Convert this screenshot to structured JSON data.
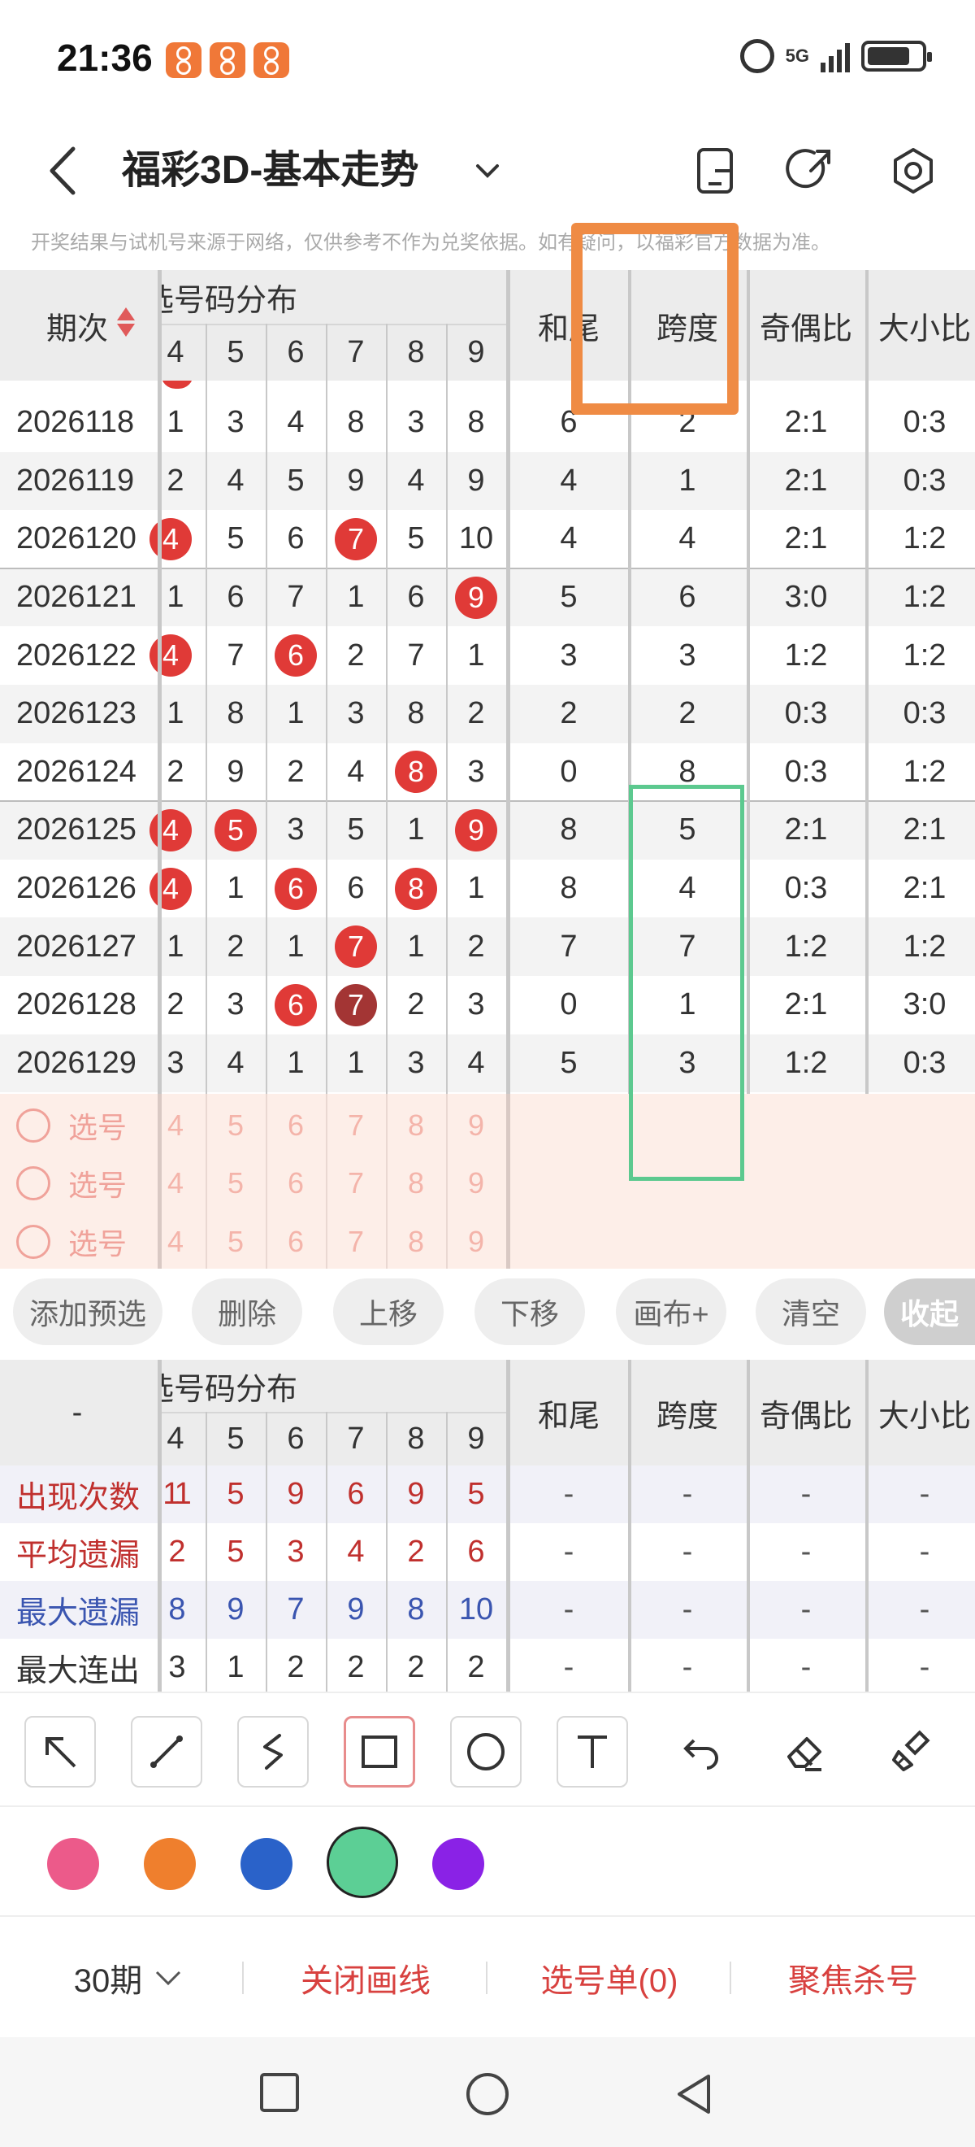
{
  "status_bar": {
    "time": "21:36",
    "network": "5G"
  },
  "header": {
    "title": "福彩3D-基本走势"
  },
  "notice": "开奖结果与试机号来源于网络，仅供参考不作为兑奖依据。如有疑问，以福彩官方数据为准。",
  "main_table": {
    "header": {
      "period": "期次",
      "group": "选号码分布",
      "numbers": [
        "4",
        "5",
        "6",
        "7",
        "8",
        "9"
      ],
      "cols": [
        "和尾",
        "跨度",
        "奇偶比",
        "大小比"
      ]
    },
    "rows": [
      {
        "period": "2026118",
        "nums": [
          "1",
          "3",
          "4",
          "8",
          "3",
          "8"
        ],
        "hl": [],
        "he": "6",
        "kd": "2",
        "jo": "2:1",
        "dx": "0:3"
      },
      {
        "period": "2026119",
        "nums": [
          "2",
          "4",
          "5",
          "9",
          "4",
          "9"
        ],
        "hl": [],
        "he": "4",
        "kd": "1",
        "jo": "2:1",
        "dx": "0:3"
      },
      {
        "period": "2026120",
        "nums": [
          "4",
          "5",
          "6",
          "7",
          "5",
          "10"
        ],
        "hl": [
          0,
          3
        ],
        "he": "4",
        "kd": "4",
        "jo": "2:1",
        "dx": "1:2"
      },
      {
        "period": "2026121",
        "nums": [
          "1",
          "6",
          "7",
          "1",
          "6",
          "9"
        ],
        "hl": [
          5
        ],
        "he": "5",
        "kd": "6",
        "jo": "3:0",
        "dx": "1:2"
      },
      {
        "period": "2026122",
        "nums": [
          "4",
          "7",
          "6",
          "2",
          "7",
          "1"
        ],
        "hl": [
          0,
          2
        ],
        "he": "3",
        "kd": "3",
        "jo": "1:2",
        "dx": "1:2"
      },
      {
        "period": "2026123",
        "nums": [
          "1",
          "8",
          "1",
          "3",
          "8",
          "2"
        ],
        "hl": [],
        "he": "2",
        "kd": "2",
        "jo": "0:3",
        "dx": "0:3"
      },
      {
        "period": "2026124",
        "nums": [
          "2",
          "9",
          "2",
          "4",
          "8",
          "3"
        ],
        "hl": [
          4
        ],
        "he": "0",
        "kd": "8",
        "jo": "0:3",
        "dx": "1:2"
      },
      {
        "period": "2026125",
        "nums": [
          "4",
          "5",
          "3",
          "5",
          "1",
          "9"
        ],
        "hl": [
          0,
          1,
          5
        ],
        "he": "8",
        "kd": "5",
        "jo": "2:1",
        "dx": "2:1"
      },
      {
        "period": "2026126",
        "nums": [
          "4",
          "1",
          "6",
          "6",
          "8",
          "1"
        ],
        "hl": [
          0,
          2,
          4
        ],
        "he": "8",
        "kd": "4",
        "jo": "0:3",
        "dx": "2:1"
      },
      {
        "period": "2026127",
        "nums": [
          "1",
          "2",
          "1",
          "7",
          "1",
          "2"
        ],
        "hl": [
          3
        ],
        "he": "7",
        "kd": "7",
        "jo": "1:2",
        "dx": "1:2"
      },
      {
        "period": "2026128",
        "nums": [
          "2",
          "3",
          "6",
          "7",
          "2",
          "3"
        ],
        "hl": [
          2,
          3
        ],
        "dark": [
          3
        ],
        "he": "0",
        "kd": "1",
        "jo": "2:1",
        "dx": "3:0"
      },
      {
        "period": "2026129",
        "nums": [
          "3",
          "4",
          "1",
          "1",
          "3",
          "4"
        ],
        "hl": [],
        "he": "5",
        "kd": "3",
        "jo": "1:2",
        "dx": "0:3"
      }
    ]
  },
  "pick_rows": [
    {
      "label": "选号",
      "nums": [
        "4",
        "5",
        "6",
        "7",
        "8",
        "9"
      ]
    },
    {
      "label": "选号",
      "nums": [
        "4",
        "5",
        "6",
        "7",
        "8",
        "9"
      ]
    },
    {
      "label": "选号",
      "nums": [
        "4",
        "5",
        "6",
        "7",
        "8",
        "9"
      ]
    }
  ],
  "actions": [
    "添加预选",
    "删除",
    "上移",
    "下移",
    "画布+",
    "清空",
    "收起"
  ],
  "stats_table": {
    "header": {
      "period": "-",
      "group": "选号码分布",
      "numbers": [
        "4",
        "5",
        "6",
        "7",
        "8",
        "9"
      ],
      "cols": [
        "和尾",
        "跨度",
        "奇偶比",
        "大小比"
      ]
    },
    "rows": [
      {
        "label": "出现次数",
        "color": "red",
        "vals": [
          "11",
          "5",
          "9",
          "6",
          "9",
          "5"
        ],
        "tail": [
          "-",
          "-",
          "-",
          "-"
        ]
      },
      {
        "label": "平均遗漏",
        "color": "red",
        "vals": [
          "2",
          "5",
          "3",
          "4",
          "2",
          "6"
        ],
        "tail": [
          "-",
          "-",
          "-",
          "-"
        ]
      },
      {
        "label": "最大遗漏",
        "color": "blue",
        "vals": [
          "8",
          "9",
          "7",
          "9",
          "8",
          "10"
        ],
        "tail": [
          "-",
          "-",
          "-",
          "-"
        ]
      },
      {
        "label": "最大连出",
        "color": "plain",
        "vals": [
          "3",
          "1",
          "2",
          "2",
          "2",
          "2"
        ],
        "tail": [
          "-",
          "-",
          "-",
          "-"
        ]
      }
    ]
  },
  "draw_tools": [
    "arrow-icon",
    "line-icon",
    "freehand-icon",
    "rectangle-icon",
    "circle-icon",
    "text-icon",
    "undo-icon",
    "eraser-icon",
    "clear-brush-icon"
  ],
  "selected_tool": "rectangle-icon",
  "colors": [
    "#ec5a8a",
    "#ef7f2d",
    "#2a62c9",
    "#5ccf95",
    "#8a22e6"
  ],
  "selected_color": "#5ccf95",
  "bottom_bar": {
    "period_select": "30期",
    "close_lines": "关闭画线",
    "pick_list": "选号单(0)",
    "focus_kill": "聚焦杀号"
  }
}
